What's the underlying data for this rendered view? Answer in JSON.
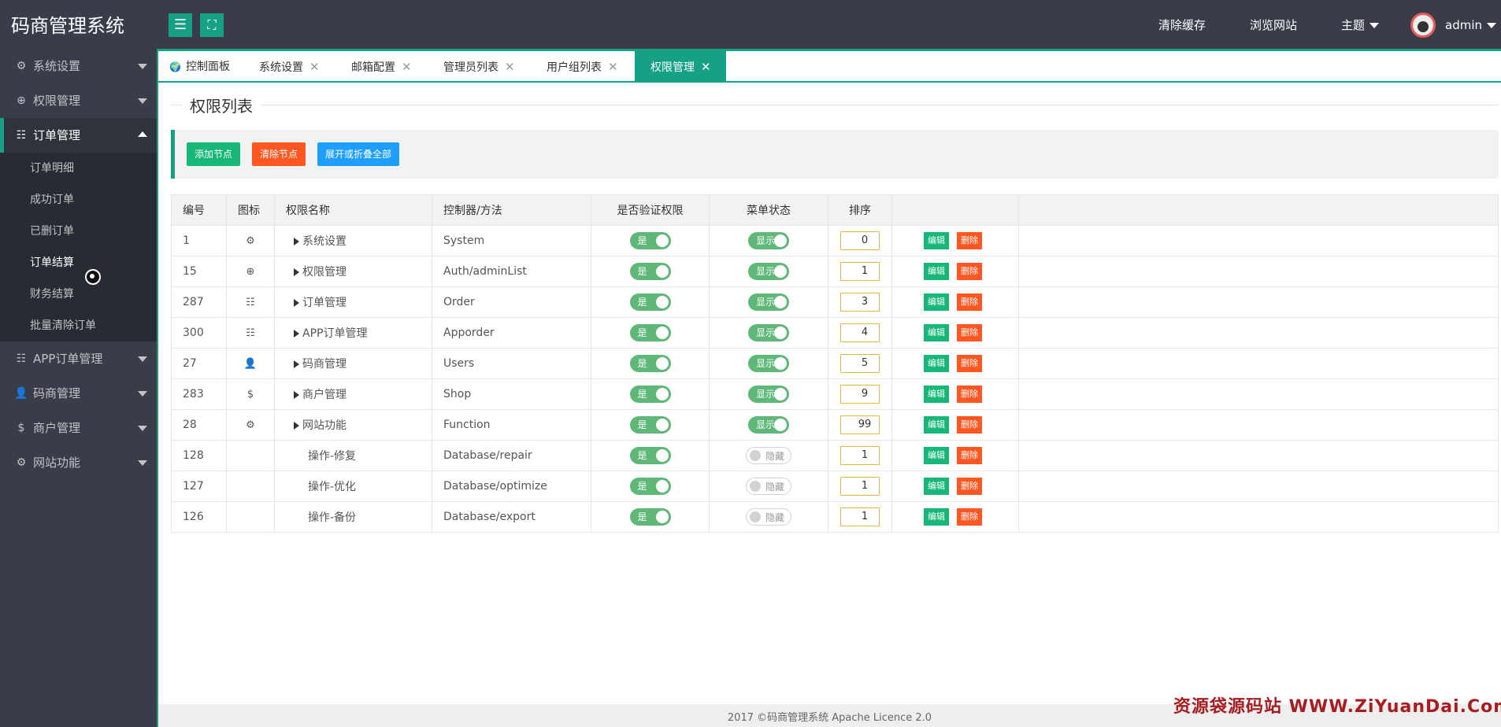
{
  "header": {
    "logo": "码商管理系统",
    "menu_icon": "☰",
    "fullscreen_icon": "⛶",
    "clear_cache": "清除缓存",
    "browse_site": "浏览网站",
    "theme": "主题",
    "user": "admin"
  },
  "sidebar": {
    "items": [
      {
        "label": "系统设置",
        "icon": "⚙"
      },
      {
        "label": "权限管理",
        "icon": "⊕"
      },
      {
        "label": "订单管理",
        "icon": "☷"
      },
      {
        "label": "APP订单管理",
        "icon": "☷"
      },
      {
        "label": "码商管理",
        "icon": "👤"
      },
      {
        "label": "商户管理",
        "icon": "$"
      },
      {
        "label": "网站功能",
        "icon": "⚙"
      }
    ],
    "sub_items": [
      "订单明细",
      "成功订单",
      "已删订单",
      "订单结算",
      "财务结算",
      "批量清除订单"
    ]
  },
  "tabs": [
    {
      "label": "控制面板",
      "icon": "🌍"
    },
    {
      "label": "系统设置",
      "close": "✕"
    },
    {
      "label": "邮箱配置",
      "close": "✕"
    },
    {
      "label": "管理员列表",
      "close": "✕"
    },
    {
      "label": "用户组列表",
      "close": "✕"
    },
    {
      "label": "权限管理",
      "close": "✕"
    }
  ],
  "page": {
    "title": "权限列表",
    "buttons": {
      "add": "添加节点",
      "clear": "清除节点",
      "expand": "展开或折叠全部"
    }
  },
  "table": {
    "headers": [
      "编号",
      "图标",
      "权限名称",
      "控制器/方法",
      "是否验证权限",
      "菜单状态",
      "排序",
      ""
    ],
    "edit_label": "编辑",
    "delete_label": "删除",
    "rows": [
      {
        "id": "1",
        "icon": "⚙",
        "name": "系统设置",
        "ctrl": "System",
        "auth": "是",
        "menu": "显示",
        "sort": "0"
      },
      {
        "id": "15",
        "icon": "⊕",
        "name": "权限管理",
        "ctrl": "Auth/adminList",
        "auth": "是",
        "menu": "显示",
        "sort": "1"
      },
      {
        "id": "287",
        "icon": "☷",
        "name": "订单管理",
        "ctrl": "Order",
        "auth": "是",
        "menu": "显示",
        "sort": "3"
      },
      {
        "id": "300",
        "icon": "☷",
        "name": "APP订单管理",
        "ctrl": "Apporder",
        "auth": "是",
        "menu": "显示",
        "sort": "4"
      },
      {
        "id": "27",
        "icon": "👤",
        "name": "码商管理",
        "ctrl": "Users",
        "auth": "是",
        "menu": "显示",
        "sort": "5"
      },
      {
        "id": "283",
        "icon": "$",
        "name": "商户管理",
        "ctrl": "Shop",
        "auth": "是",
        "menu": "显示",
        "sort": "9"
      },
      {
        "id": "28",
        "icon": "⚙",
        "name": "网站功能",
        "ctrl": "Function",
        "auth": "是",
        "menu": "显示",
        "sort": "99"
      },
      {
        "id": "128",
        "icon": "",
        "name": "操作-修复",
        "ctrl": "Database/repair",
        "auth": "是",
        "menu": "隐藏",
        "sort": "1"
      },
      {
        "id": "127",
        "icon": "",
        "name": "操作-优化",
        "ctrl": "Database/optimize",
        "auth": "是",
        "menu": "隐藏",
        "sort": "1"
      },
      {
        "id": "126",
        "icon": "",
        "name": "操作-备份",
        "ctrl": "Database/export",
        "auth": "是",
        "menu": "隐藏",
        "sort": "1"
      }
    ]
  },
  "footer": "2017 ©码商管理系统 Apache Licence 2.0",
  "watermark": "资源袋源码站 WWW.ZiYuanDai.Com",
  "colors": {
    "accent": "#16a085",
    "orange": "#ff5722",
    "blue": "#1e9fff",
    "sidebar": "#393d49"
  }
}
